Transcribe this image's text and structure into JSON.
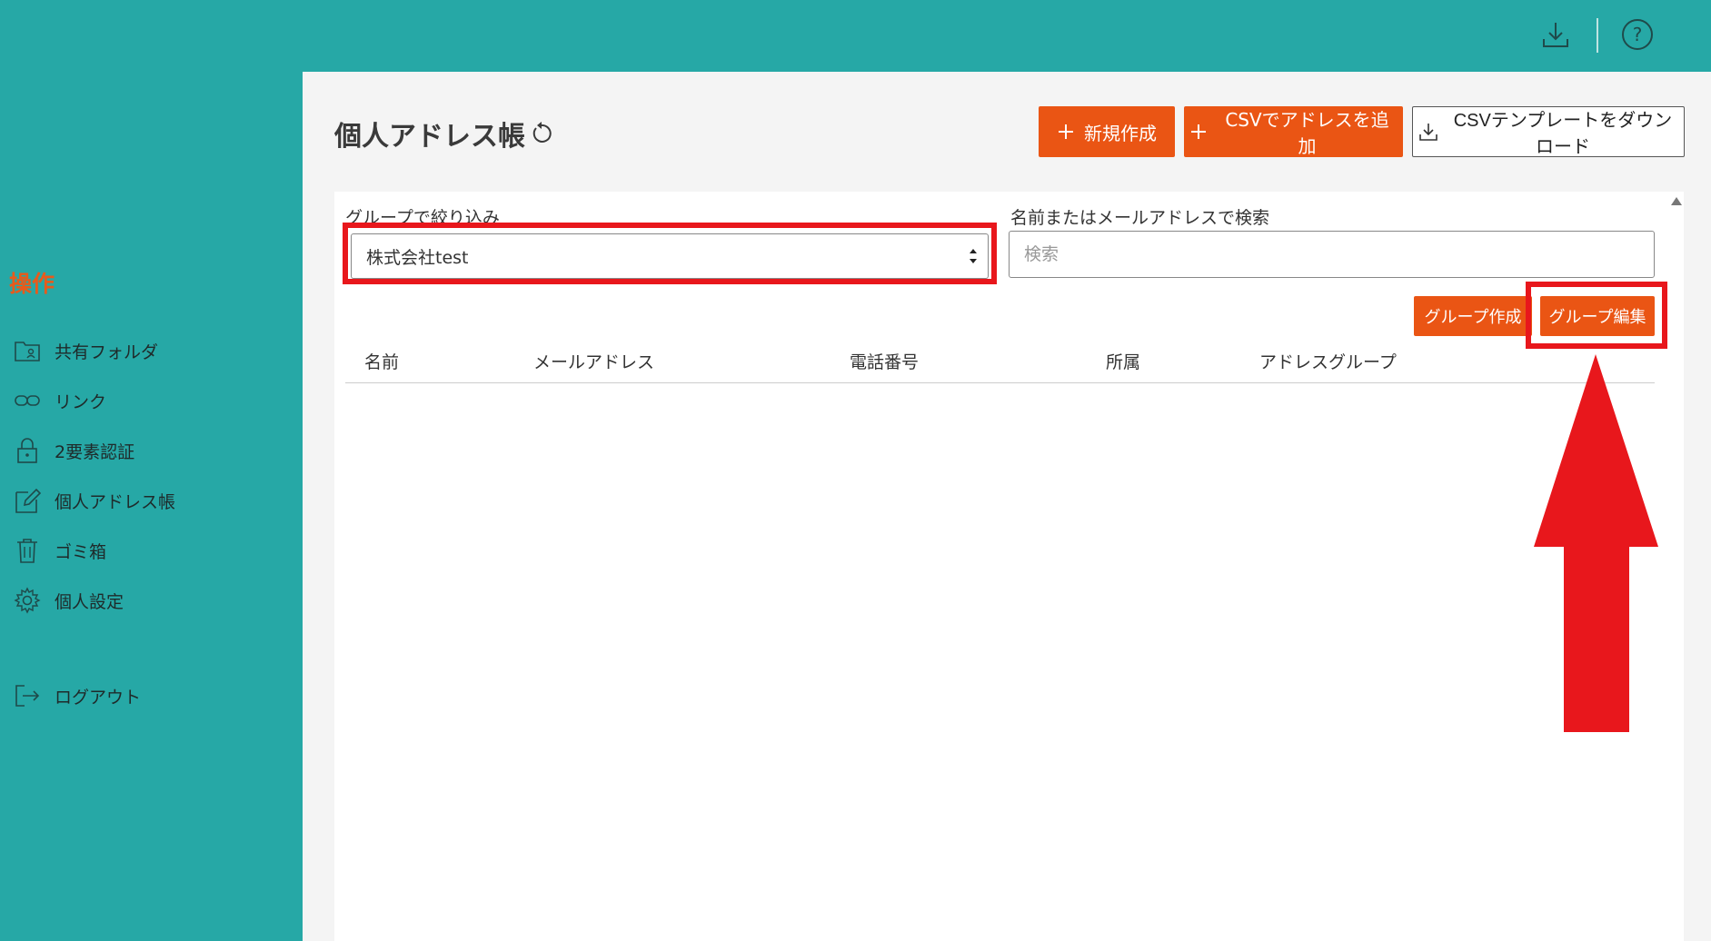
{
  "topbar": {
    "download_icon": "download-icon",
    "help_icon": "help-icon"
  },
  "sidebar": {
    "heading": "操作",
    "items": [
      {
        "label": "共有フォルダ",
        "icon": "folder-icon"
      },
      {
        "label": "リンク",
        "icon": "link-icon"
      },
      {
        "label": "2要素認証",
        "icon": "lock-icon"
      },
      {
        "label": "個人アドレス帳",
        "icon": "edit-icon"
      },
      {
        "label": "ゴミ箱",
        "icon": "trash-icon"
      },
      {
        "label": "個人設定",
        "icon": "gear-icon"
      },
      {
        "label": "ログアウト",
        "icon": "logout-icon"
      }
    ]
  },
  "page": {
    "title": "個人アドレス帳",
    "buttons": {
      "new": "新規作成",
      "csv_add": "CSVでアドレスを追加",
      "csv_template": "CSVテンプレートをダウンロード"
    },
    "filter": {
      "label": "グループで絞り込み",
      "selected": "株式会社test"
    },
    "search": {
      "label": "名前またはメールアドレスで検索",
      "placeholder": "検索"
    },
    "group_create": "グループ作成",
    "group_edit": "グループ編集",
    "table": {
      "columns": [
        "名前",
        "メールアドレス",
        "電話番号",
        "所属",
        "アドレスグループ"
      ]
    }
  },
  "colors": {
    "teal": "#26a8a6",
    "orange": "#ea5514",
    "highlight": "#e8171c"
  }
}
